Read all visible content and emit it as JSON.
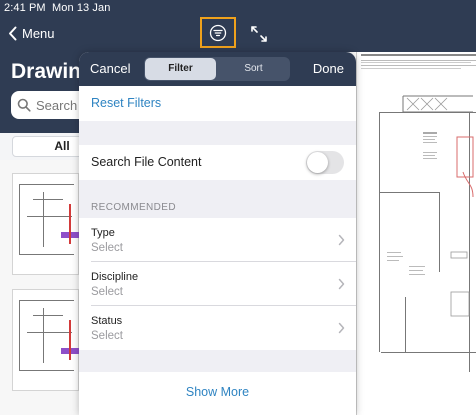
{
  "status_bar": {
    "time": "2:41 PM",
    "date": "Mon 13 Jan"
  },
  "nav": {
    "back_label": "Menu",
    "title": "Drawin"
  },
  "background_search": {
    "placeholder": "Search"
  },
  "background_segment": {
    "selected": "All"
  },
  "icons": {
    "filter": "filter-lines-icon",
    "expand": "expand-arrows-icon",
    "back": "chevron-left-icon",
    "search": "magnifier-icon",
    "disclosure": "chevron-right-icon"
  },
  "colors": {
    "header": "#2f3c53",
    "accent_link": "#2f84c2",
    "highlight_border": "#f0a21c"
  },
  "popover": {
    "cancel_label": "Cancel",
    "done_label": "Done",
    "segments": [
      {
        "label": "Filter",
        "selected": true
      },
      {
        "label": "Sort",
        "selected": false
      }
    ],
    "reset_filters": "Reset Filters",
    "search_file_content": {
      "label": "Search File Content",
      "enabled": false
    },
    "recommended_header": "RECOMMENDED",
    "recommended": [
      {
        "label": "Type",
        "value": "Select"
      },
      {
        "label": "Discipline",
        "value": "Select"
      },
      {
        "label": "Status",
        "value": "Select"
      }
    ],
    "show_more": "Show More"
  }
}
